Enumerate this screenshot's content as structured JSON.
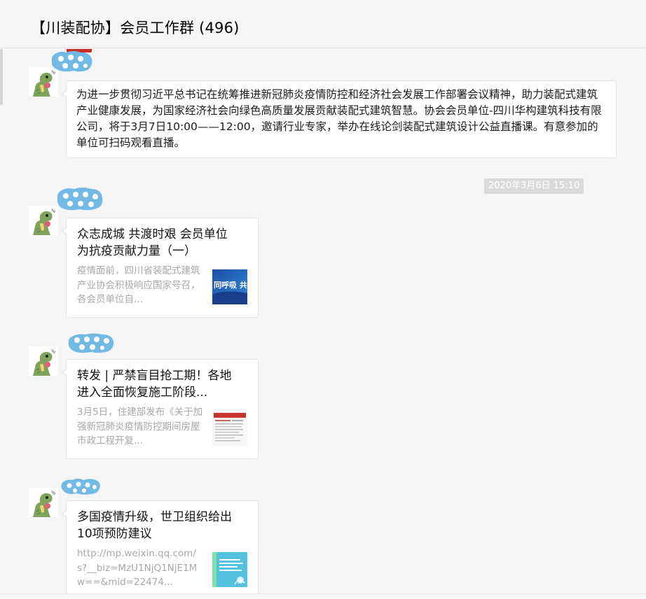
{
  "header": {
    "title": "【川装配协】会员工作群 (496)"
  },
  "messages": [
    {
      "type": "text",
      "text": "为进一步贯彻习近平总书记在统筹推进新冠肺炎疫情防控和经济社会发展工作部署会议精神，助力装配式建筑产业健康发展，为国家经济社会向绿色高质量发展贡献装配式建筑智慧。协会会员单位-四川华构建筑科技有限公司，将于3月7日10:00——12:00，邀请行业专家，举办在线论剑装配式建筑设计公益直播课。有意参加的单位可扫码观看直播。"
    },
    {
      "type": "timestamp",
      "text": "2020年3月6日 15:10"
    },
    {
      "type": "card",
      "title": "众志成城 共渡时艰 会员单位为抗疫贡献力量（一）",
      "desc": "疫情面前，四川省装配式建筑产业协会积极响应国家号召，各会员单位自...",
      "thumb_text": "同呼吸 共战疫"
    },
    {
      "type": "card",
      "title": "转发 | 严禁盲目抢工期！各地进入全面恢复施工阶段...",
      "desc": "3月5日，住建部发布《关于加强新冠肺炎疫情防控期间房屋市政工程开复..."
    },
    {
      "type": "card",
      "title": "多国疫情升级，世卫组织给出10项预防建议",
      "desc": "http://mp.weixin.qq.com/s?__biz=MzU1NjQ1NjE1Mw==&mid=22474..."
    }
  ],
  "icons": {
    "avatar": "dinosaur-avatar-icon",
    "nickname": "blurred-nickname-icon"
  },
  "colors": {
    "background": "#f5f5f5",
    "bubble": "#ffffff",
    "timestamp_bg": "#dadada",
    "nickname_blob": "#72b9e6"
  }
}
